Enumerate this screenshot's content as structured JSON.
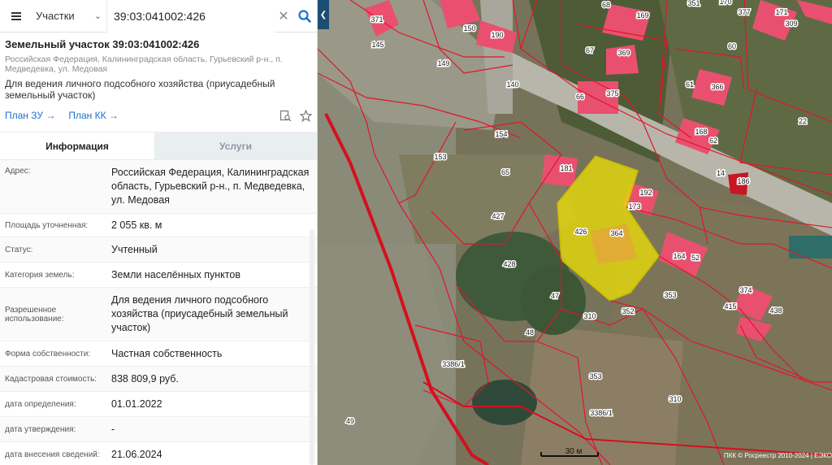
{
  "search": {
    "type_label": "Участки",
    "query": "39:03:041002:426"
  },
  "parcel": {
    "title": "Земельный участок 39:03:041002:426",
    "address_short": "Российская Федерация, Калининградская область, Гурьевский р-н., п. Медведевка, ул. Медовая",
    "permitted_use": "Для ведения личного подсобного хозяйства (приусадебный земельный участок)",
    "link_plan_zu": "План ЗУ →",
    "link_plan_kk": "План КК →"
  },
  "tabs": {
    "info": "Информация",
    "services": "Услуги"
  },
  "info_rows": [
    {
      "label": "Адрес:",
      "value": "Российская Федерация, Калининградская область, Гурьевский р-н., п. Медведевка, ул. Медовая"
    },
    {
      "label": "Площадь уточненная:",
      "value": "2 055 кв. м"
    },
    {
      "label": "Статус:",
      "value": "Учтенный"
    },
    {
      "label": "Категория земель:",
      "value": "Земли населённых пунктов"
    },
    {
      "label": "Разрешенное использование:",
      "value": "Для ведения личного подсобного хозяйства (приусадебный земельный участок)"
    },
    {
      "label": "Форма собственности:",
      "value": "Частная собственность"
    },
    {
      "label": "Кадастровая стоимость:",
      "value": "838 809,9 руб."
    },
    {
      "label": "дата определения:",
      "value": "01.01.2022"
    },
    {
      "label": "дата утверждения:",
      "value": "-"
    },
    {
      "label": "дата внесения сведений:",
      "value": "21.06.2024"
    }
  ],
  "map": {
    "parcel_labels": [
      "371",
      "145",
      "150",
      "190",
      "149",
      "140",
      "68",
      "169",
      "67",
      "369",
      "66",
      "375",
      "351",
      "170",
      "377",
      "171",
      "309",
      "60",
      "61",
      "366",
      "62",
      "168",
      "22",
      "154",
      "153",
      "65",
      "181",
      "14",
      "186",
      "173",
      "192",
      "427",
      "426",
      "364",
      "428",
      "47",
      "48",
      "310",
      "352",
      "164",
      "52",
      "353",
      "415",
      "374",
      "438",
      "3386/1",
      "49",
      "353",
      "310",
      "3386/1"
    ],
    "highlighted_parcel": "426",
    "scale_label": "30 м",
    "attribution": "ПКК © Росреестр 2010-2024 | ЕЭКО"
  },
  "colors": {
    "accent": "#1c6fd1",
    "boundary": "#e0162b",
    "highlight": "#f2e600",
    "roof": "#e94a6a"
  },
  "icons": {
    "menu": "hamburger-icon",
    "dropdown": "chevron-down-icon",
    "clear": "close-icon",
    "search": "search-icon",
    "locate": "map-search-icon",
    "favorite": "star-icon",
    "collapse": "chevron-left-icon"
  }
}
